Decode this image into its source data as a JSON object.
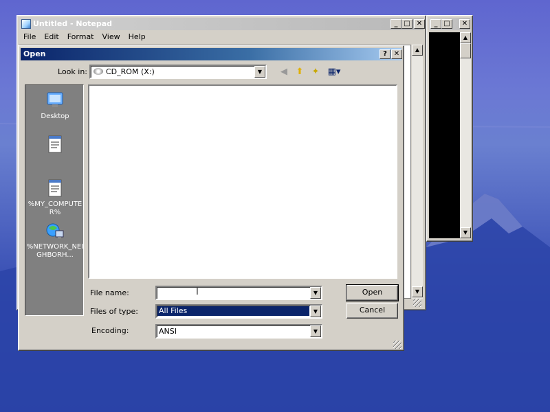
{
  "notepad_bg": {
    "title": "",
    "buttons": {
      "minimize": "_",
      "maximize": "□",
      "close": "✕"
    },
    "scroll_up": "▲",
    "scroll_down": "▼"
  },
  "notepad": {
    "title": "Untitled - Notepad",
    "buttons": {
      "minimize": "_",
      "maximize": "□",
      "close": "✕"
    },
    "menu": [
      "File",
      "Edit",
      "Format",
      "View",
      "Help"
    ],
    "scroll_up": "▲",
    "scroll_down": "▼"
  },
  "open_dialog": {
    "title": "Open",
    "help_button": "?",
    "close_button": "✕",
    "look_in_label": "Look in:",
    "look_in_value": "CD_ROM (X:)",
    "places": [
      {
        "label": "Desktop",
        "icon": "desktop-icon"
      },
      {
        "label": "",
        "icon": "notepad-file-icon"
      },
      {
        "label": "%MY_COMPUTER%",
        "icon": "notepad-file-icon"
      },
      {
        "label": "%NETWORK_NEIGHBORH...",
        "icon": "network-icon"
      }
    ],
    "file_name_label": "File name:",
    "file_name_value": "",
    "files_of_type_label": "Files of type:",
    "files_of_type_value": "All Files",
    "encoding_label": "Encoding:",
    "encoding_value": "ANSI",
    "open_button": "Open",
    "cancel_button": "Cancel",
    "dropdown_arrow": "▼",
    "toolbar_icons": [
      "back-icon",
      "up-folder-icon",
      "new-folder-icon",
      "view-menu-icon"
    ]
  },
  "colors": {
    "titlebar_active": "#0a246a",
    "dialog_face": "#d4d0c8",
    "selection": "#0a246a"
  }
}
